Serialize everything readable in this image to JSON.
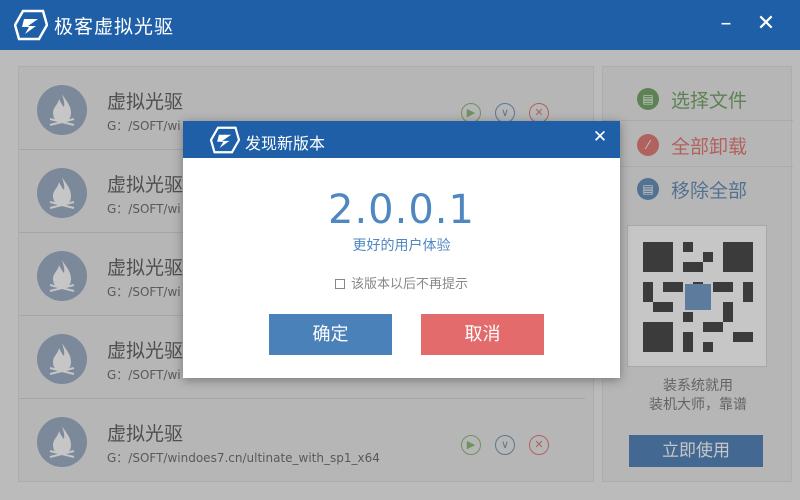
{
  "window": {
    "title": "极客虚拟光驱",
    "minimize_glyph": "–",
    "close_glyph": "✕"
  },
  "list": {
    "items": [
      {
        "name": "虚拟光驱",
        "path": "G：/SOFT/wi",
        "icon": "flame-icon"
      },
      {
        "name": "虚拟光驱",
        "path": "G：/SOFT/wi",
        "icon": "flame-icon"
      },
      {
        "name": "虚拟光驱",
        "path": "G：/SOFT/wi",
        "icon": "flame-icon"
      },
      {
        "name": "虚拟光驱",
        "path": "G：/SOFT/wi",
        "icon": "flame-icon"
      },
      {
        "name": "虚拟光驱",
        "path": "G：/SOFT/windoes7.cn/ultinate_with_sp1_x64",
        "icon": "flame-icon"
      }
    ],
    "actions": {
      "play": "▶",
      "down": "∨",
      "remove": "✕"
    }
  },
  "sidebar": {
    "select_files": "选择文件",
    "unmount_all": "全部卸载",
    "remove_all": "移除全部",
    "promo_line1": "装系统就用",
    "promo_line2": "装机大师，靠谱",
    "use_now": "立即使用",
    "colors": {
      "select": "#4a8a3a",
      "unmount": "#d9534f",
      "remove": "#3a6ea5"
    }
  },
  "dialog": {
    "title": "发现新版本",
    "close_glyph": "✕",
    "version": "2.0.0.1",
    "tagline": "更好的用户体验",
    "skip_label": "该版本以后不再提示",
    "ok_label": "确定",
    "cancel_label": "取消"
  },
  "colors": {
    "brand": "#1e5fa8",
    "ok": "#4a81b9",
    "cancel": "#e36b6b",
    "accent_text": "#4e87c1"
  }
}
